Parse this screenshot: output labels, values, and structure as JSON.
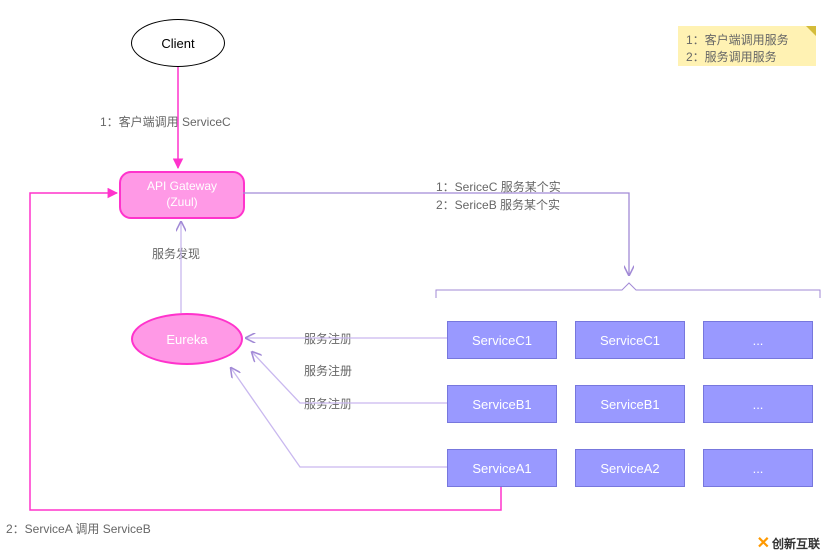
{
  "nodes": {
    "client": "Client",
    "gateway_line1": "API Gateway",
    "gateway_line2": "(Zuul)",
    "eureka": "Eureka"
  },
  "note": {
    "line1": "1：客户端调用服务",
    "line2": "2：服务调用服务"
  },
  "edges": {
    "client_to_gateway": "1：客户端调用 ServiceC",
    "gateway_discover": "服务发现",
    "gateway_to_services_1": "1：SericeC 服务某个实",
    "gateway_to_services_2": "2：SericeB 服务某个实",
    "register1": "服务注册",
    "register2": "服务注册",
    "register3": "服务注册",
    "a_calls_b": "2：ServiceA 调用 ServiceB"
  },
  "services": {
    "c1": "ServiceC1",
    "c2": "ServiceC1",
    "c3": "...",
    "b1": "ServiceB1",
    "b2": "ServiceB1",
    "b3": "...",
    "a1": "ServiceA1",
    "a2": "ServiceA2",
    "a3": "..."
  },
  "watermark": "创新互联",
  "chart_data": {
    "type": "diagram",
    "title": "Spring Cloud service discovery and API gateway flow",
    "nodes": [
      {
        "id": "client",
        "label": "Client",
        "shape": "ellipse"
      },
      {
        "id": "gateway",
        "label": "API Gateway (Zuul)",
        "shape": "roundrect",
        "color": "#ff99e6"
      },
      {
        "id": "eureka",
        "label": "Eureka",
        "shape": "ellipse",
        "color": "#ff99e6"
      },
      {
        "id": "ServiceC1_a",
        "label": "ServiceC1",
        "group": "ServiceC"
      },
      {
        "id": "ServiceC1_b",
        "label": "ServiceC1",
        "group": "ServiceC"
      },
      {
        "id": "ServiceC_more",
        "label": "...",
        "group": "ServiceC"
      },
      {
        "id": "ServiceB1_a",
        "label": "ServiceB1",
        "group": "ServiceB"
      },
      {
        "id": "ServiceB1_b",
        "label": "ServiceB1",
        "group": "ServiceB"
      },
      {
        "id": "ServiceB_more",
        "label": "...",
        "group": "ServiceB"
      },
      {
        "id": "ServiceA1",
        "label": "ServiceA1",
        "group": "ServiceA"
      },
      {
        "id": "ServiceA2",
        "label": "ServiceA2",
        "group": "ServiceA"
      },
      {
        "id": "ServiceA_more",
        "label": "...",
        "group": "ServiceA"
      }
    ],
    "edges": [
      {
        "from": "client",
        "to": "gateway",
        "label": "1：客户端调用 ServiceC"
      },
      {
        "from": "gateway",
        "to": "services",
        "label": "1：SericeC 服务某个实 / 2：SericeB 服务某个实"
      },
      {
        "from": "eureka",
        "to": "gateway",
        "label": "服务发现"
      },
      {
        "from": "ServiceC1_a",
        "to": "eureka",
        "label": "服务注册"
      },
      {
        "from": "ServiceB1_a",
        "to": "eureka",
        "label": "服务注册"
      },
      {
        "from": "ServiceA1",
        "to": "eureka",
        "label": "服务注册"
      },
      {
        "from": "ServiceA1",
        "to": "gateway",
        "label": "2：ServiceA 调用 ServiceB"
      }
    ],
    "legend": [
      "1：客户端调用服务",
      "2：服务调用服务"
    ]
  }
}
